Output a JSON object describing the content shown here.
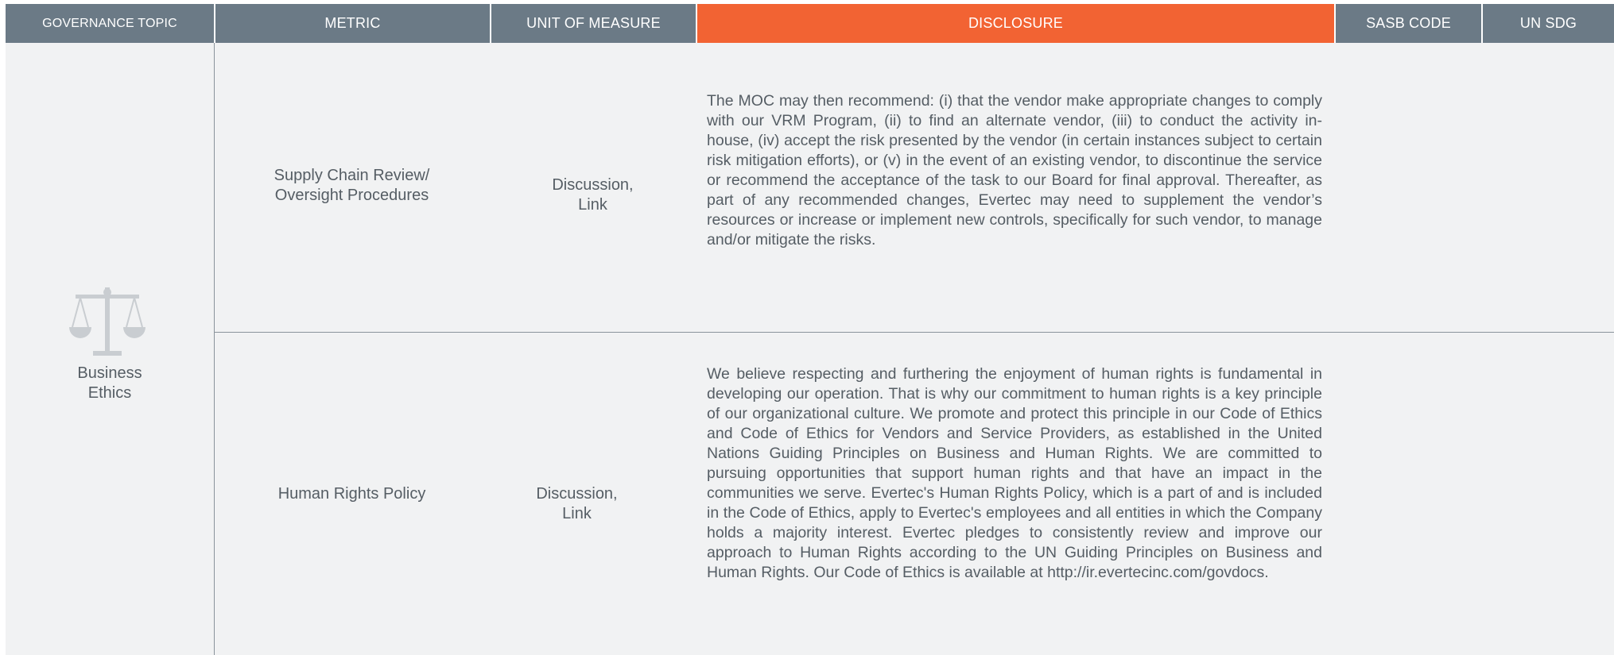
{
  "header": {
    "governance_topic": "GOVERNANCE TOPIC",
    "metric": "METRIC",
    "unit_of_measure": "UNIT OF MEASURE",
    "disclosure": "DISCLOSURE",
    "sasb_code": "SASB CODE",
    "un_sdg": "UN SDG"
  },
  "colors": {
    "header_bg": "#6b7a86",
    "disclosure_accent": "#f26333",
    "body_bg": "#f1f2f3",
    "text": "#555d64"
  },
  "topic": {
    "icon": "scales-of-justice-icon",
    "label": "Business\nEthics"
  },
  "rows": [
    {
      "metric": "Supply Chain Review/\nOversight Procedures",
      "unit": "Discussion,\nLink",
      "disclosure": "The MOC may then recommend: (i) that the vendor make appropriate changes to comply with our VRM Program, (ii) to find an alternate vendor, (iii) to conduct the activity in-house, (iv) accept the risk presented by the vendor (in certain instances subject to certain risk mitigation efforts), or (v) in the event of an existing vendor, to discontinue the service or recommend the acceptance of the task to our Board for final approval. Thereafter, as part of any recommended changes, Evertec may need to supplement the vendor’s resources or increase or implement new controls, specifically for such vendor, to manage and/or mitigate the risks.",
      "sasb_code": "",
      "un_sdg": ""
    },
    {
      "metric": "Human Rights Policy",
      "unit": "Discussion,\nLink",
      "disclosure": "We believe respecting and furthering the enjoyment of human rights is fundamental in developing our operation. That is why our commitment to human rights is a key principle of our organizational culture. We promote and protect this principle in our Code of Ethics and Code of Ethics for Vendors and Service Providers, as established in the United Nations Guiding Principles on Business and Human Rights. We are committed to pursuing opportunities that support human rights and that have an impact in the communities we serve. Evertec's Human Rights Policy, which is a part of and is included in the Code of Ethics, apply to Evertec's employees and all entities in which the Company holds a majority interest. Evertec pledges to consistently review and improve our approach to Human Rights according to the UN Guiding Principles on Business and Human Rights. Our Code of Ethics is available at http://ir.evertecinc.com/govdocs.",
      "sasb_code": "",
      "un_sdg": ""
    }
  ]
}
